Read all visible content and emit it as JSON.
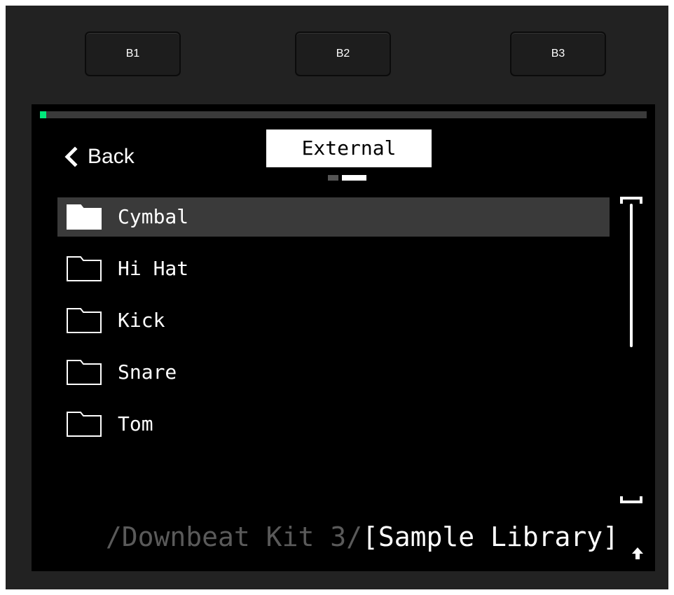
{
  "hardware_buttons": [
    {
      "label": "B1"
    },
    {
      "label": "B2"
    },
    {
      "label": "B3"
    }
  ],
  "screen": {
    "progress": 0.01,
    "accent_color": "#00e87b",
    "back": {
      "label": "Back",
      "icon": "chevron-left-icon"
    },
    "location_tab": {
      "label": "External"
    },
    "page_indicator": {
      "count": 2,
      "active_index": 1
    },
    "items": [
      {
        "label": "Cymbal",
        "icon": "folder-icon",
        "selected": true
      },
      {
        "label": "Hi Hat",
        "icon": "folder-outline-icon",
        "selected": false
      },
      {
        "label": "Kick",
        "icon": "folder-outline-icon",
        "selected": false
      },
      {
        "label": "Snare",
        "icon": "folder-outline-icon",
        "selected": false
      },
      {
        "label": "Tom",
        "icon": "folder-outline-icon",
        "selected": false
      }
    ],
    "scroll_position": 0.0,
    "path": {
      "prefix": "/Downbeat Kit 3/",
      "current": "[Sample Library]"
    },
    "up_icon": "arrow-up-icon"
  }
}
